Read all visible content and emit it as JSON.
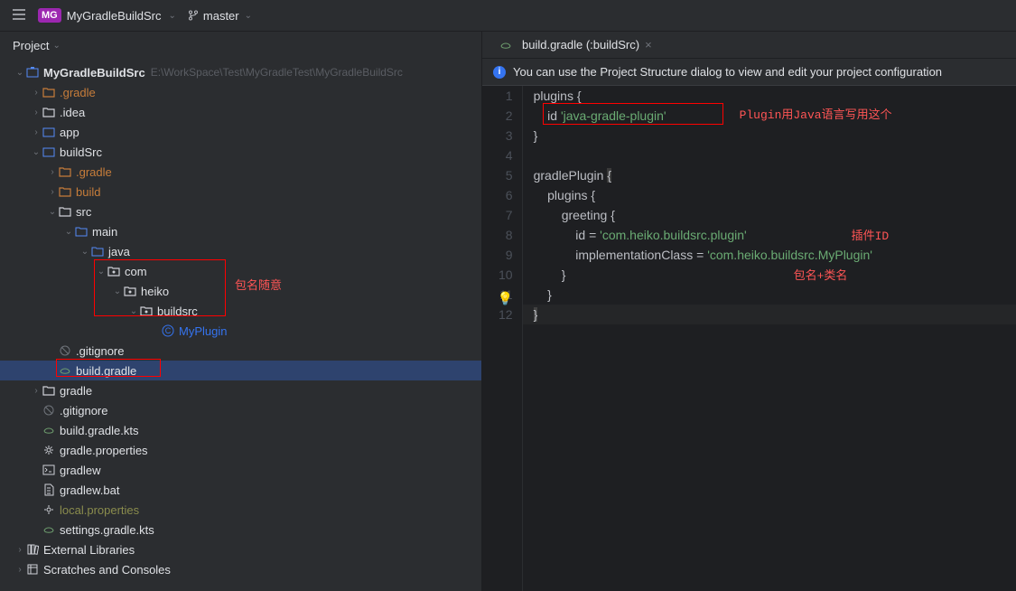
{
  "titlebar": {
    "badge": "MG",
    "project": "MyGradleBuildSrc",
    "branch": "master"
  },
  "sidebar": {
    "header": "Project",
    "root": {
      "name": "MyGradleBuildSrc",
      "path": "E:\\WorkSpace\\Test\\MyGradleTest\\MyGradleBuildSrc"
    },
    "items": {
      "gradle_hidden": ".gradle",
      "idea": ".idea",
      "app": "app",
      "buildSrc": "buildSrc",
      "bs_gradle": ".gradle",
      "bs_build": "build",
      "bs_src": "src",
      "bs_main": "main",
      "bs_java": "java",
      "bs_com": "com",
      "bs_heiko": "heiko",
      "bs_buildsrc": "buildsrc",
      "bs_myplugin": "MyPlugin",
      "bs_gitignore": ".gitignore",
      "bs_buildgradle": "build.gradle",
      "gradle": "gradle",
      "gitignore": ".gitignore",
      "buildgradlekts": "build.gradle.kts",
      "gradleprops": "gradle.properties",
      "gradlew": "gradlew",
      "gradlewbat": "gradlew.bat",
      "localprops": "local.properties",
      "settingsgradle": "settings.gradle.kts",
      "extlib": "External Libraries",
      "scratches": "Scratches and Consoles"
    }
  },
  "editor": {
    "tab": "build.gradle (:buildSrc)",
    "banner": "You can use the Project Structure dialog to view and edit your project configuration",
    "lines": [
      "plugins {",
      "    id 'java-gradle-plugin'",
      "}",
      "",
      "gradlePlugin {",
      "    plugins {",
      "        greeting {",
      "            id = 'com.heiko.buildsrc.plugin'",
      "            implementationClass = 'com.heiko.buildsrc.MyPlugin'",
      "        }",
      "    }",
      "}"
    ]
  },
  "annotations": {
    "pkg": "包名随意",
    "plugin_lang": "Plugin用Java语言写用这个",
    "plugin_id": "插件ID",
    "pkg_class": "包名+类名"
  }
}
